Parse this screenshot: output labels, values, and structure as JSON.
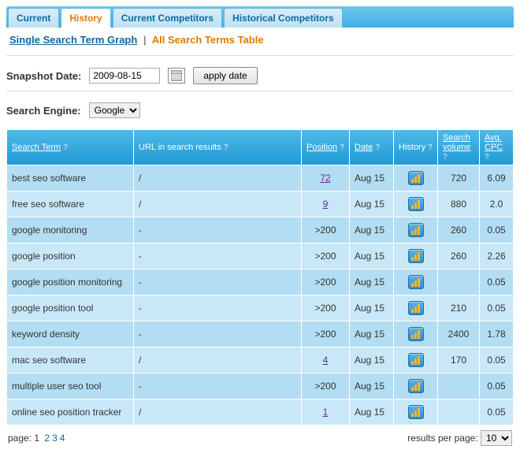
{
  "tabs": [
    {
      "label": "Current",
      "active": false
    },
    {
      "label": "History",
      "active": true
    },
    {
      "label": "Current Competitors",
      "active": false
    },
    {
      "label": "Historical Competitors",
      "active": false
    }
  ],
  "subnav": {
    "link": "Single Search Term Graph",
    "sep": "|",
    "active": "All Search Terms Table"
  },
  "snapshot": {
    "label": "Snapshot Date:",
    "value": "2009-08-15",
    "apply": "apply date"
  },
  "engine": {
    "label": "Search Engine:",
    "value": "Google"
  },
  "headers": {
    "term": "Search Term",
    "url": "URL in search results",
    "position": "Position",
    "date": "Date",
    "history": "History",
    "volume": "Search volume",
    "cpc": "Avg. CPC",
    "q": "?"
  },
  "rows": [
    {
      "term": "best seo software",
      "url": "/",
      "position": "72",
      "pos_link": true,
      "date": "Aug 15",
      "volume": "720",
      "cpc": "6.09"
    },
    {
      "term": "free seo software",
      "url": "/",
      "position": "9",
      "pos_link": true,
      "date": "Aug 15",
      "volume": "880",
      "cpc": "2.0"
    },
    {
      "term": "google monitoring",
      "url": "-",
      "position": ">200",
      "pos_link": false,
      "date": "Aug 15",
      "volume": "260",
      "cpc": "0.05"
    },
    {
      "term": "google position",
      "url": "-",
      "position": ">200",
      "pos_link": false,
      "date": "Aug 15",
      "volume": "260",
      "cpc": "2.26"
    },
    {
      "term": "google position monitoring",
      "url": "-",
      "position": ">200",
      "pos_link": false,
      "date": "Aug 15",
      "volume": "",
      "cpc": "0.05"
    },
    {
      "term": "google position tool",
      "url": "-",
      "position": ">200",
      "pos_link": false,
      "date": "Aug 15",
      "volume": "210",
      "cpc": "0.05"
    },
    {
      "term": "keyword density",
      "url": "-",
      "position": ">200",
      "pos_link": false,
      "date": "Aug 15",
      "volume": "2400",
      "cpc": "1.78"
    },
    {
      "term": "mac seo software",
      "url": "/",
      "position": "4",
      "pos_link": true,
      "date": "Aug 15",
      "volume": "170",
      "cpc": "0.05"
    },
    {
      "term": "multiple user seo tool",
      "url": "-",
      "position": ">200",
      "pos_link": false,
      "date": "Aug 15",
      "volume": "",
      "cpc": "0.05"
    },
    {
      "term": "online seo position tracker",
      "url": "/",
      "position": "1",
      "pos_link": true,
      "date": "Aug 15",
      "volume": "",
      "cpc": "0.05"
    }
  ],
  "footer": {
    "page_label": "page:",
    "current_page": "1",
    "pages": [
      "2",
      "3",
      "4"
    ],
    "rpp_label": "results per page:",
    "rpp_value": "10"
  }
}
